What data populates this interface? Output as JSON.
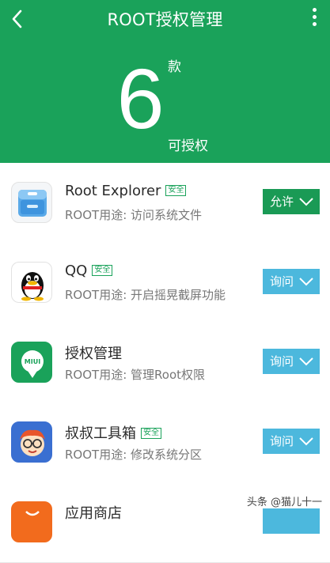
{
  "header": {
    "title": "ROOT授权管理",
    "back_icon": "chevron-left-icon",
    "more_icon": "more-vertical-icon",
    "background": "#1aa25a"
  },
  "summary": {
    "count": "6",
    "unit": "款",
    "label": "可授权"
  },
  "apps": [
    {
      "name": "Root Explorer",
      "badge": "安全",
      "desc": "ROOT用途: 访问系统文件",
      "action": "允许",
      "action_state": "allow",
      "icon": "file-cabinet-icon"
    },
    {
      "name": "QQ",
      "badge": "安全",
      "desc": "ROOT用途: 开启摇晃截屏功能",
      "action": "询问",
      "action_state": "ask",
      "icon": "penguin-icon"
    },
    {
      "name": "授权管理",
      "badge": "",
      "desc": "ROOT用途: 管理Root权限",
      "action": "询问",
      "action_state": "ask",
      "icon": "miui-shield-icon"
    },
    {
      "name": "叔叔工具箱",
      "badge": "安全",
      "desc": "ROOT用途: 修改系统分区",
      "action": "询问",
      "action_state": "ask",
      "icon": "uncle-face-icon"
    },
    {
      "name": "应用商店",
      "badge": "",
      "desc": "",
      "action": "",
      "action_state": "ask",
      "icon": "shopping-bag-icon"
    }
  ],
  "colors": {
    "accent": "#1aa25a",
    "allow": "#1a9a55",
    "ask": "#4cb8dd"
  },
  "watermark": "头条 @猫儿十一"
}
